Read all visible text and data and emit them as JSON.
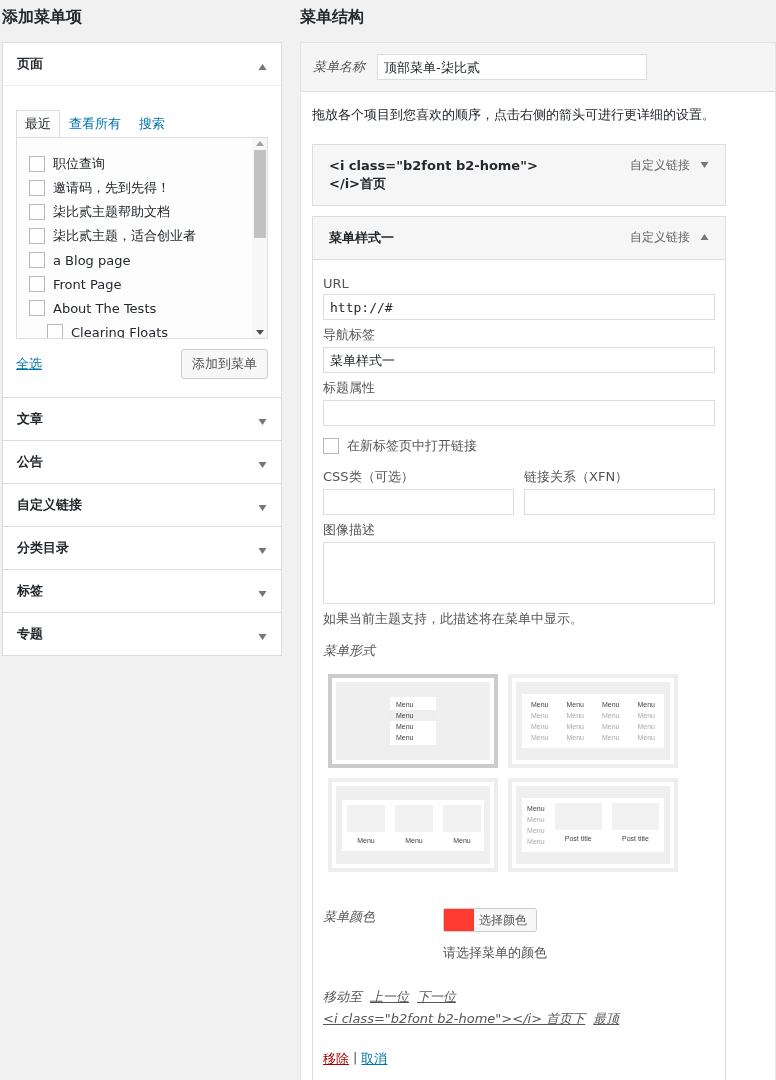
{
  "left": {
    "title": "添加菜单项",
    "sections": [
      {
        "title": "页面",
        "expanded": true
      },
      {
        "title": "文章",
        "expanded": false
      },
      {
        "title": "公告",
        "expanded": false
      },
      {
        "title": "自定义链接",
        "expanded": false
      },
      {
        "title": "分类目录",
        "expanded": false
      },
      {
        "title": "标签",
        "expanded": false
      },
      {
        "title": "专题",
        "expanded": false
      }
    ],
    "tabs": [
      {
        "label": "最近",
        "selected": true
      },
      {
        "label": "查看所有",
        "selected": false
      },
      {
        "label": "搜索",
        "selected": false
      }
    ],
    "pages": [
      {
        "label": "职位查询",
        "checked": false
      },
      {
        "label": "邀请码，先到先得！",
        "checked": false
      },
      {
        "label": "柒比贰主题帮助文档",
        "checked": false
      },
      {
        "label": "柒比贰主题，适合创业者",
        "checked": false
      },
      {
        "label": "a Blog page",
        "checked": false
      },
      {
        "label": "Front Page",
        "checked": false
      },
      {
        "label": "About The Tests",
        "checked": false,
        "children": [
          {
            "label": "Clearing Floats",
            "checked": false
          }
        ]
      }
    ],
    "select_all": "全选",
    "add_button": "添加到菜单"
  },
  "right": {
    "title": "菜单结构",
    "name_label": "菜单名称",
    "name_value": "顶部菜单-柒比贰",
    "instructions": "拖放各个项目到您喜欢的顺序，点击右侧的箭头可进行更详细的设置。",
    "items": [
      {
        "title": "<i class=\"b2font b2-home\"></i>首页",
        "type": "自定义链接",
        "expanded": false
      },
      {
        "title": "菜单样式一",
        "type": "自定义链接",
        "expanded": true
      }
    ],
    "editor": {
      "url_label": "URL",
      "url_value": "http://#",
      "nav_label": "导航标签",
      "nav_value": "菜单样式一",
      "attr_label": "标题属性",
      "new_tab": {
        "label": "在新标签页中打开链接",
        "checked": false
      },
      "css_label": "CSS类（可选）",
      "xfn_label": "链接关系（XFN）",
      "desc_label": "图像描述",
      "desc_hint": "如果当前主题支持，此描述将在菜单中显示。",
      "style_label": "菜单形式",
      "styles": [
        {
          "kind": "dropdown",
          "selected": true,
          "menu": [
            "Menu",
            "Menu",
            "Menu",
            "Menu"
          ]
        },
        {
          "kind": "mega",
          "selected": false,
          "columns": [
            [
              "Menu",
              "Menu",
              "Menu",
              "Menu"
            ],
            [
              "Menu",
              "Menu",
              "Menu",
              "Menu"
            ],
            [
              "Menu",
              "Menu",
              "Menu",
              "Menu"
            ],
            [
              "Menu",
              "Menu",
              "Menu",
              "Menu"
            ]
          ]
        },
        {
          "kind": "cards",
          "selected": false,
          "menu": [
            "Menu",
            "Menu",
            "Menu"
          ]
        },
        {
          "kind": "posts",
          "selected": false,
          "menu": [
            "Menu",
            "Menu",
            "Menu",
            "Menu"
          ],
          "posts": [
            "Post title",
            "Post title"
          ]
        }
      ],
      "color_label": "菜单颜色",
      "color": "#ff3b2f",
      "color_button": "选择颜色",
      "color_hint": "请选择菜单的颜色",
      "move_label": "移动至",
      "move_links": [
        "上一位",
        "下一位",
        "<i class=\"b2font b2-home\"></i> 首页下",
        "最顶"
      ],
      "remove": "移除",
      "separator": "|",
      "cancel": "取消"
    }
  }
}
